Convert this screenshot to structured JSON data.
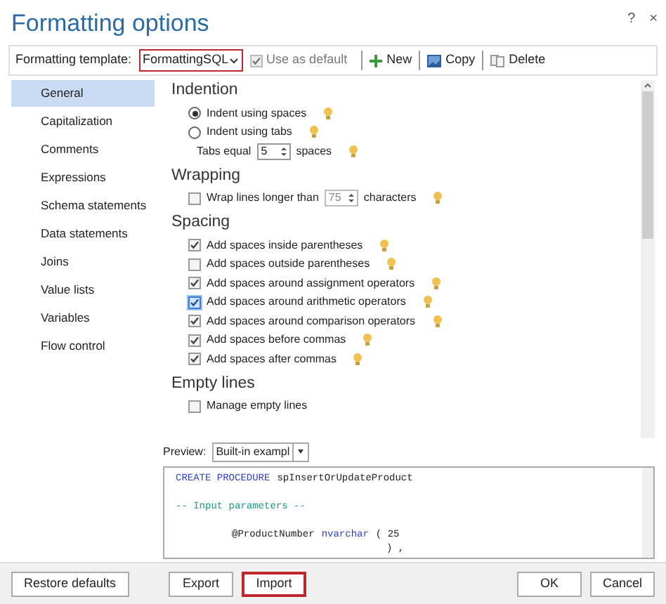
{
  "window": {
    "title": "Formatting options",
    "help": "?",
    "close": "×"
  },
  "toolbar": {
    "template_label": "Formatting template:",
    "template_value": "FormattingSQL",
    "use_as_default": {
      "label": "Use as default",
      "checked": true,
      "disabled": true
    },
    "buttons": [
      {
        "label": "New"
      },
      {
        "label": "Copy"
      },
      {
        "label": "Delete"
      }
    ]
  },
  "sidebar": {
    "items": [
      {
        "label": "General",
        "selected": true
      },
      {
        "label": "Capitalization",
        "selected": false
      },
      {
        "label": "Comments",
        "selected": false
      },
      {
        "label": "Expressions",
        "selected": false
      },
      {
        "label": "Schema statements",
        "selected": false
      },
      {
        "label": "Data statements",
        "selected": false
      },
      {
        "label": "Joins",
        "selected": false
      },
      {
        "label": "Value lists",
        "selected": false
      },
      {
        "label": "Variables",
        "selected": false
      },
      {
        "label": "Flow control",
        "selected": false
      }
    ]
  },
  "sections": [
    {
      "heading": "Indention",
      "options": [
        {
          "kind": "radio",
          "label": "Indent using spaces",
          "selected": true,
          "hint": true
        },
        {
          "kind": "radio",
          "label": "Indent using tabs",
          "selected": false,
          "hint": true
        },
        {
          "kind": "spinner",
          "label": "Tabs equal",
          "value": "5",
          "suffix": "spaces",
          "disabled": false,
          "hint": true
        }
      ]
    },
    {
      "heading": "Wrapping",
      "options": [
        {
          "kind": "checkspinner",
          "label": "Wrap lines longer than",
          "checked": false,
          "value": "75",
          "suffix": "characters",
          "disabled": true,
          "hint": true
        }
      ]
    },
    {
      "heading": "Spacing",
      "options": [
        {
          "kind": "checkbox",
          "label": "Add spaces inside parentheses",
          "checked": true,
          "focused": false,
          "hint": true
        },
        {
          "kind": "checkbox",
          "label": "Add spaces outside parentheses",
          "checked": false,
          "focused": false,
          "hint": true
        },
        {
          "kind": "checkbox",
          "label": "Add spaces around assignment operators",
          "checked": true,
          "focused": false,
          "hint": true
        },
        {
          "kind": "checkbox",
          "label": "Add spaces around arithmetic operators",
          "checked": true,
          "focused": true,
          "hint": true
        },
        {
          "kind": "checkbox",
          "label": "Add spaces around comparison operators",
          "checked": true,
          "focused": false,
          "hint": true
        },
        {
          "kind": "checkbox",
          "label": "Add spaces before commas",
          "checked": true,
          "focused": false,
          "hint": true
        },
        {
          "kind": "checkbox",
          "label": "Add spaces after commas",
          "checked": true,
          "focused": false,
          "hint": true
        }
      ]
    },
    {
      "heading": "Empty lines",
      "options": [
        {
          "kind": "checkbox",
          "label": "Manage empty lines",
          "checked": false,
          "focused": false,
          "hint": false
        }
      ]
    }
  ],
  "preview": {
    "label": "Preview:",
    "value": "Built-in exampl",
    "lines": [
      {
        "kind": "code",
        "tokens": [
          {
            "text": "CREATE PROCEDURE",
            "kind": "keyword"
          },
          {
            "text": "spInsertOrUpdateProduct",
            "kind": "plain"
          }
        ]
      },
      {
        "kind": "blank"
      },
      {
        "kind": "code",
        "tokens": [
          {
            "text": "-- Input parameters --",
            "kind": "comment"
          }
        ]
      },
      {
        "kind": "blank"
      },
      {
        "kind": "code",
        "tokens": [
          {
            "text": "@ProductNumber",
            "kind": "plain"
          },
          {
            "text": "nvarchar",
            "kind": "keyword"
          },
          {
            "text": "( 25",
            "kind": "plain"
          }
        ]
      },
      {
        "kind": "code",
        "tokens": [
          {
            "text": ") ,",
            "kind": "plain"
          }
        ]
      }
    ]
  },
  "footer": {
    "buttons": [
      {
        "label": "Restore defaults",
        "highlighted": false
      },
      {
        "label": "Export",
        "highlighted": false
      },
      {
        "label": "Import",
        "highlighted": true
      },
      {
        "label": "OK",
        "highlighted": false
      },
      {
        "label": "Cancel",
        "highlighted": false
      }
    ]
  }
}
